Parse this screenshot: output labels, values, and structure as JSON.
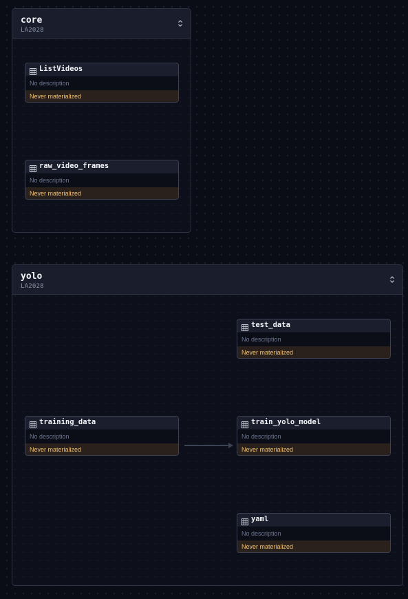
{
  "groups": [
    {
      "title": "core",
      "subtitle": "LA2028",
      "nodes": [
        {
          "name": "ListVideos",
          "description": "No description",
          "status": "Never materialized"
        },
        {
          "name": "raw_video_frames",
          "description": "No description",
          "status": "Never materialized"
        }
      ]
    },
    {
      "title": "yolo",
      "subtitle": "LA2028",
      "nodes": [
        {
          "name": "test_data",
          "description": "No description",
          "status": "Never materialized"
        },
        {
          "name": "training_data",
          "description": "No description",
          "status": "Never materialized"
        },
        {
          "name": "train_yolo_model",
          "description": "No description",
          "status": "Never materialized"
        },
        {
          "name": "yaml",
          "description": "No description",
          "status": "Never materialized"
        }
      ]
    }
  ],
  "icons": {
    "node": "table-icon",
    "collapse": "chevron-collapse-icon"
  },
  "colors": {
    "background": "#0a0c16",
    "status_text": "#f0c174",
    "status_bg": "#2a211d",
    "edge": "#3b4254"
  }
}
